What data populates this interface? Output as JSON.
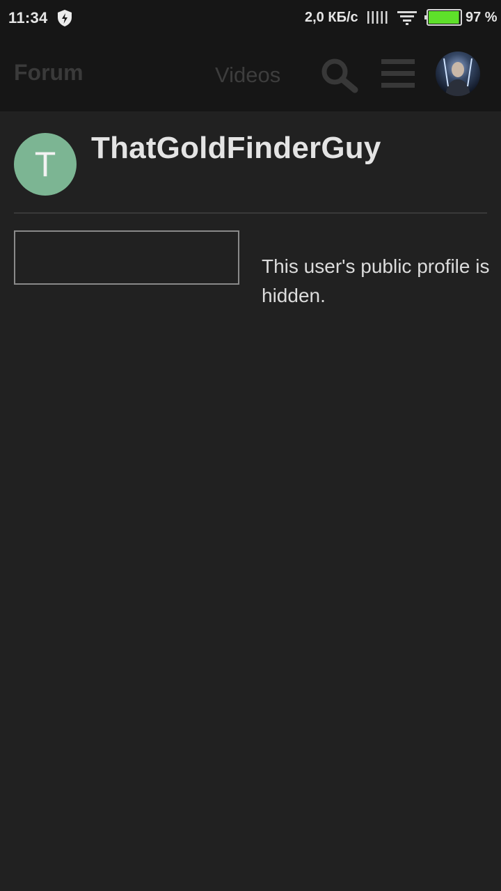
{
  "status_bar": {
    "time": "11:34",
    "network_speed": "2,0 КБ/с",
    "battery_percent": "97 %",
    "battery_level": 0.97,
    "battery_color": "#5ee02a",
    "icons": [
      "shield-bolt-icon",
      "signal-bars-icon",
      "wifi-icon",
      "battery-icon"
    ]
  },
  "header": {
    "nav_forum": "Forum",
    "nav_videos": "Videos",
    "icons": [
      "search-icon",
      "menu-icon",
      "user-avatar"
    ]
  },
  "profile": {
    "avatar_letter": "T",
    "avatar_color": "#7cb593",
    "username": "ThatGoldFinderGuy",
    "hidden_message": "This user's public profile is hidden."
  }
}
